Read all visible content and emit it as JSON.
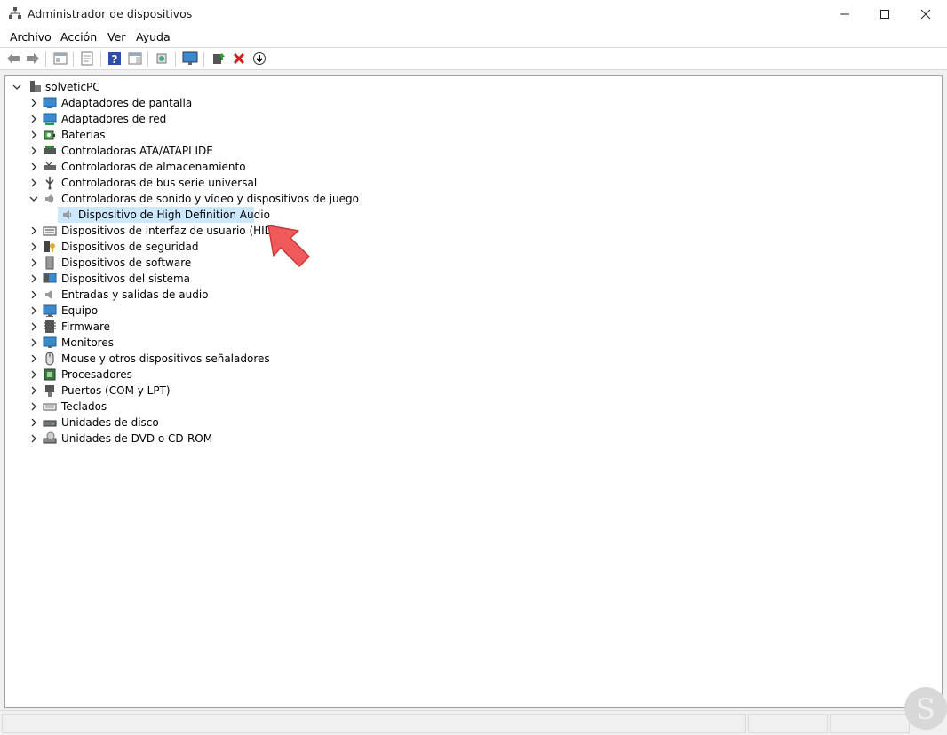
{
  "window": {
    "title": "Administrador de dispositivos"
  },
  "menu": [
    "Archivo",
    "Acción",
    "Ver",
    "Ayuda"
  ],
  "toolbar": [
    "back-icon",
    "forward-icon",
    "show-hide-console-tree-icon",
    "properties-icon",
    "help-icon",
    "action-pane-icon",
    "scan-hardware-icon",
    "computer-monitor-icon",
    "update-driver-icon",
    "uninstall-icon",
    "disable-device-icon"
  ],
  "tree": {
    "root": "solveticPC",
    "items": [
      {
        "label": "Adaptadores de pantalla",
        "icon": "display-adapter-icon"
      },
      {
        "label": "Adaptadores de red",
        "icon": "network-adapter-icon"
      },
      {
        "label": "Baterías",
        "icon": "battery-icon"
      },
      {
        "label": "Controladoras ATA/ATAPI IDE",
        "icon": "ide-controller-icon"
      },
      {
        "label": "Controladoras de almacenamiento",
        "icon": "storage-controller-icon"
      },
      {
        "label": "Controladoras de bus serie universal",
        "icon": "usb-controller-icon"
      },
      {
        "label": "Controladoras de sonido y vídeo y dispositivos de juego",
        "icon": "speaker-icon",
        "expanded": true
      },
      {
        "label": "Dispositivos de interfaz de usuario (HID)",
        "icon": "hid-icon"
      },
      {
        "label": "Dispositivos de seguridad",
        "icon": "security-key-icon"
      },
      {
        "label": "Dispositivos de software",
        "icon": "software-device-icon"
      },
      {
        "label": "Dispositivos del sistema",
        "icon": "system-device-icon"
      },
      {
        "label": "Entradas y salidas de audio",
        "icon": "audio-io-icon"
      },
      {
        "label": "Equipo",
        "icon": "computer-icon"
      },
      {
        "label": "Firmware",
        "icon": "firmware-icon"
      },
      {
        "label": "Monitores",
        "icon": "monitor-icon"
      },
      {
        "label": "Mouse y otros dispositivos señaladores",
        "icon": "mouse-icon"
      },
      {
        "label": "Procesadores",
        "icon": "processor-icon"
      },
      {
        "label": "Puertos (COM y LPT)",
        "icon": "port-icon"
      },
      {
        "label": "Teclados",
        "icon": "keyboard-icon"
      },
      {
        "label": "Unidades de disco",
        "icon": "disk-drive-icon"
      },
      {
        "label": "Unidades de DVD o CD-ROM",
        "icon": "dvd-drive-icon"
      }
    ],
    "child": {
      "label": "Dispositivo de High Definition Audio",
      "icon": "speaker-icon"
    }
  },
  "colors": {
    "selection": "#cce8ff",
    "arrow": "#f05a5a"
  }
}
